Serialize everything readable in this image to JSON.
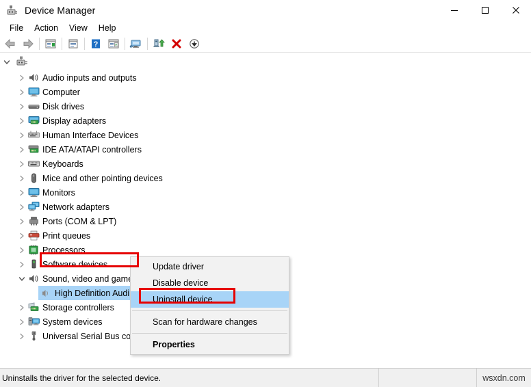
{
  "window": {
    "title": "Device Manager",
    "icon": "device-manager-icon",
    "controls": {
      "minimize": "—",
      "maximize": "□",
      "close": "✕"
    }
  },
  "menubar": {
    "items": [
      {
        "label": "File",
        "name": "menu-file"
      },
      {
        "label": "Action",
        "name": "menu-action"
      },
      {
        "label": "View",
        "name": "menu-view"
      },
      {
        "label": "Help",
        "name": "menu-help"
      }
    ]
  },
  "toolbar": {
    "buttons": [
      {
        "name": "back-button",
        "icon": "back-arrow-icon",
        "label": "Back"
      },
      {
        "name": "forward-button",
        "icon": "forward-arrow-icon",
        "label": "Forward"
      },
      {
        "name": "show-hide-console-tree-button",
        "icon": "console-tree-icon",
        "label": "Show/Hide Console Tree"
      },
      {
        "name": "properties-button",
        "icon": "properties-window-icon",
        "label": "Properties"
      },
      {
        "name": "help-button",
        "icon": "help-question-icon",
        "label": "Help"
      },
      {
        "name": "show-hide-action-pane-button",
        "icon": "action-pane-icon",
        "label": "Show/Hide Action Pane"
      },
      {
        "name": "scan-hardware-changes-button",
        "icon": "scan-monitor-icon",
        "label": "Scan for hardware changes"
      },
      {
        "name": "update-driver-button",
        "icon": "update-driver-icon",
        "label": "Update driver"
      },
      {
        "name": "uninstall-device-button",
        "icon": "red-x-icon",
        "label": "Uninstall device"
      },
      {
        "name": "disable-device-button",
        "icon": "down-arrow-circle-icon",
        "label": "Disable device"
      }
    ]
  },
  "tree": {
    "root": {
      "label": "",
      "icon": "computer-root-icon",
      "expanded": true
    },
    "nodes": [
      {
        "label": "Audio inputs and outputs",
        "icon": "speaker-icon",
        "expanded": false
      },
      {
        "label": "Computer",
        "icon": "monitor-icon",
        "expanded": false
      },
      {
        "label": "Disk drives",
        "icon": "disk-drive-icon",
        "expanded": false
      },
      {
        "label": "Display adapters",
        "icon": "display-adapter-icon",
        "expanded": false
      },
      {
        "label": "Human Interface Devices",
        "icon": "hid-icon",
        "expanded": false
      },
      {
        "label": "IDE ATA/ATAPI controllers",
        "icon": "ide-controller-icon",
        "expanded": false
      },
      {
        "label": "Keyboards",
        "icon": "keyboard-icon",
        "expanded": false
      },
      {
        "label": "Mice and other pointing devices",
        "icon": "mouse-icon",
        "expanded": false
      },
      {
        "label": "Monitors",
        "icon": "monitor-icon",
        "expanded": false
      },
      {
        "label": "Network adapters",
        "icon": "network-adapter-icon",
        "expanded": false
      },
      {
        "label": "Ports (COM & LPT)",
        "icon": "port-icon",
        "expanded": false
      },
      {
        "label": "Print queues",
        "icon": "printer-icon",
        "expanded": false
      },
      {
        "label": "Processors",
        "icon": "processor-icon",
        "expanded": false
      },
      {
        "label": "Software devices",
        "icon": "software-device-icon",
        "expanded": false
      },
      {
        "label": "Sound, video and game controllers",
        "icon": "speaker-icon",
        "expanded": true
      }
    ],
    "selected_child": {
      "label": "High Definition Audi",
      "icon": "audio-device-icon",
      "selected": true
    },
    "nodes_after": [
      {
        "label": "Storage controllers",
        "icon": "storage-controller-icon",
        "expanded": false
      },
      {
        "label": "System devices",
        "icon": "system-device-icon",
        "expanded": false
      },
      {
        "label": "Universal Serial Bus cont",
        "icon": "usb-icon",
        "expanded": false
      }
    ]
  },
  "context_menu": {
    "items": [
      {
        "label": "Update driver",
        "name": "ctx-update-driver",
        "highlighted": false,
        "bold": false
      },
      {
        "label": "Disable device",
        "name": "ctx-disable-device",
        "highlighted": false,
        "bold": false
      },
      {
        "label": "Uninstall device",
        "name": "ctx-uninstall-device",
        "highlighted": true,
        "bold": false
      },
      {
        "separator": true
      },
      {
        "label": "Scan for hardware changes",
        "name": "ctx-scan-hardware-changes",
        "highlighted": false,
        "bold": false
      },
      {
        "separator": true
      },
      {
        "label": "Properties",
        "name": "ctx-properties",
        "highlighted": false,
        "bold": true
      }
    ]
  },
  "statusbar": {
    "message": "Uninstalls the driver for the selected device.",
    "middle": "",
    "watermark": "wsxdn.com"
  },
  "colors": {
    "selection": "#a8d4f7",
    "annotation_red": "#e60000",
    "menu_bg": "#f2f2f2",
    "status_bg": "#f0f0f0"
  }
}
